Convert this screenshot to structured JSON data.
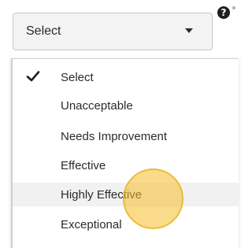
{
  "select": {
    "value": "Select",
    "caret_icon": "caret-down-icon"
  },
  "help": {
    "icon": "question-circle-icon",
    "glyph": "?"
  },
  "dropdown": {
    "options": [
      {
        "label": "Select",
        "selected": true
      },
      {
        "label": "Unacceptable",
        "selected": false
      },
      {
        "label": "Needs Improvement",
        "selected": false
      },
      {
        "label": "Effective",
        "selected": false
      },
      {
        "label": "Highly Effective",
        "selected": false,
        "hovered": true
      },
      {
        "label": "Exceptional",
        "selected": false
      }
    ]
  },
  "colors": {
    "select_bg": "#f3f3f3",
    "hover_bg": "#f1f1f1",
    "touch_indicator": "#f5bd28",
    "text": "#2b2b2b"
  }
}
